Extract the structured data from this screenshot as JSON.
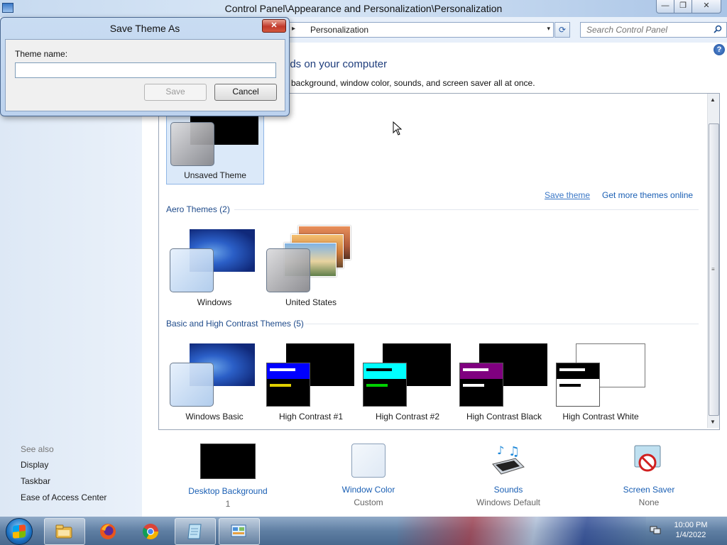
{
  "window": {
    "title": "Control Panel\\Appearance and Personalization\\Personalization",
    "controls": {
      "minimize": "—",
      "maximize": "❐",
      "close": "✕"
    }
  },
  "navbar": {
    "chevron": "▸",
    "breadcrumb": "Personalization",
    "dropdown": "▾",
    "refresh": "⟳",
    "search_placeholder": "Search Control Panel"
  },
  "main": {
    "heading_visible": "nds on your computer",
    "subheading_visible": "p background, window color, sounds, and screen saver all at once.",
    "help": "?"
  },
  "my_themes": {
    "items": [
      {
        "label": "Unsaved Theme"
      }
    ],
    "save_link": "Save theme",
    "more_link": "Get more themes online"
  },
  "aero_themes": {
    "title": "Aero Themes (2)",
    "items": [
      {
        "label": "Windows"
      },
      {
        "label": "United States"
      }
    ]
  },
  "basic_themes": {
    "title": "Basic and High Contrast Themes (5)",
    "items": [
      {
        "label": "Windows Basic"
      },
      {
        "label": "High Contrast #1"
      },
      {
        "label": "High Contrast #2"
      },
      {
        "label": "High Contrast Black"
      },
      {
        "label": "High Contrast White"
      }
    ]
  },
  "colors": {
    "hc1_title": "#0000ff",
    "hc1_bar2": "#e0d000",
    "hc2_title": "#00ffff",
    "hc2_bar2": "#00d000",
    "hcblack_title": "#800080",
    "hcwhite_title": "#000000"
  },
  "see_also": {
    "label": "See also",
    "links": [
      "Display",
      "Taskbar",
      "Ease of Access Center"
    ]
  },
  "bottom_bar": [
    {
      "label": "Desktop Background",
      "value": "1"
    },
    {
      "label": "Window Color",
      "value": "Custom"
    },
    {
      "label": "Sounds",
      "value": "Windows Default"
    },
    {
      "label": "Screen Saver",
      "value": "None"
    }
  ],
  "dialog": {
    "title": "Save Theme As",
    "close": "✕",
    "field_label": "Theme name:",
    "field_value": "",
    "save": "Save",
    "cancel": "Cancel"
  },
  "taskbar": {
    "time": "10:00 PM",
    "date": "1/4/2022"
  }
}
